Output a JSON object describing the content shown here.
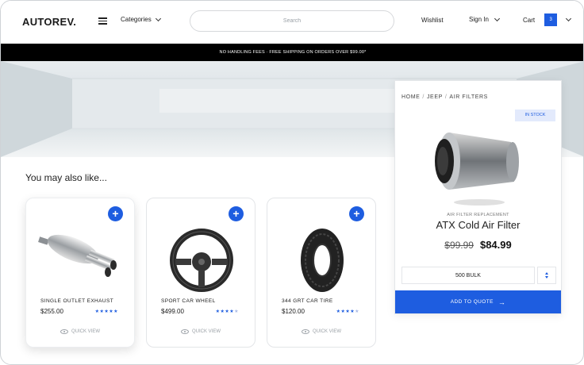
{
  "header": {
    "logo": "AUTOREV.",
    "categories_label": "Categories",
    "search_placeholder": "Search",
    "wishlist_label": "Wishlist",
    "signin_label": "Sign In",
    "cart_label": "Cart",
    "cart_count": "3"
  },
  "promo": {
    "text": "NO HANDLING FEES · FREE SHIPPING ON ORDERS OVER $99.00*"
  },
  "section": {
    "title": "You may also like..."
  },
  "products": [
    {
      "name": "SINGLE OUTLET EXHAUST",
      "price": "$255.00",
      "rating": 5,
      "quick_view": "QUICK VIEW",
      "icon": "exhaust-image"
    },
    {
      "name": "SPORT CAR WHEEL",
      "price": "$499.00",
      "rating": 4.5,
      "quick_view": "QUICK VIEW",
      "icon": "steering-wheel-image"
    },
    {
      "name": "344 GRT CAR TIRE",
      "price": "$120.00",
      "rating": 4,
      "quick_view": "QUICK VIEW",
      "icon": "tire-image"
    }
  ],
  "detail": {
    "breadcrumb": [
      "HOME",
      "JEEP",
      "AIR FILTERS"
    ],
    "stock_badge": "IN STOCK",
    "subtitle": "AIR FILTER REPLACEMENT",
    "title": "ATX Cold Air Filter",
    "old_price": "$99.99",
    "new_price": "$84.99",
    "quantity": "500 BULK",
    "add_button": "ADD TO QUOTE"
  },
  "colors": {
    "accent": "#1e5de0",
    "promo_bg": "#000000"
  }
}
